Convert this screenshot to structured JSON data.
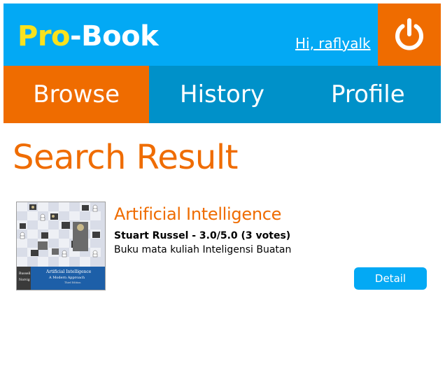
{
  "header": {
    "logo_part1": "Pro",
    "logo_part2": "-Book",
    "greeting": "Hi, raflyalk",
    "logout_icon": "power-icon"
  },
  "nav": {
    "tabs": [
      {
        "label": "Browse",
        "active": true
      },
      {
        "label": "History",
        "active": false
      },
      {
        "label": "Profile",
        "active": false
      }
    ]
  },
  "main": {
    "title": "Search Result",
    "results": [
      {
        "title": "Artificial Intelligence",
        "meta": "Stuart Russel - 3.0/5.0 (3 votes)",
        "description": "Buku mata kuliah Inteligensi Buatan",
        "button_label": "Detail",
        "cover": {
          "title": "Artificial Intelligence",
          "subtitle": "A Modern Approach",
          "edition": "Third Edition",
          "author1": "Russell",
          "author2": "Norvig"
        }
      }
    ]
  },
  "colors": {
    "primary_blue": "#03a9f4",
    "nav_blue": "#0091c9",
    "accent_orange": "#ef6c00",
    "logo_yellow": "#f9e21d"
  }
}
